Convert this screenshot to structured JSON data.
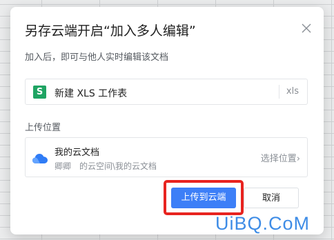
{
  "dialog": {
    "title": "另存云端开启“加入多人编辑”",
    "subtitle": "加入后，即可与他人实时编辑该文档"
  },
  "file": {
    "icon_letter": "S",
    "icon_color": "#1fa463",
    "name": "新建 XLS 工作表",
    "extension": "xls"
  },
  "location": {
    "section_label": "上传位置",
    "title": "我的云文档",
    "owner": "卿卿",
    "path": "的云空间\\我的云文档",
    "choose_label": "选择位置",
    "choose_chevron": "›"
  },
  "buttons": {
    "upload_label": "上传到云端",
    "cancel_label": "取消",
    "primary_color": "#3d7ff7",
    "highlight_color": "#e8231f"
  },
  "watermark": {
    "text": "UiBQ.CoM"
  }
}
